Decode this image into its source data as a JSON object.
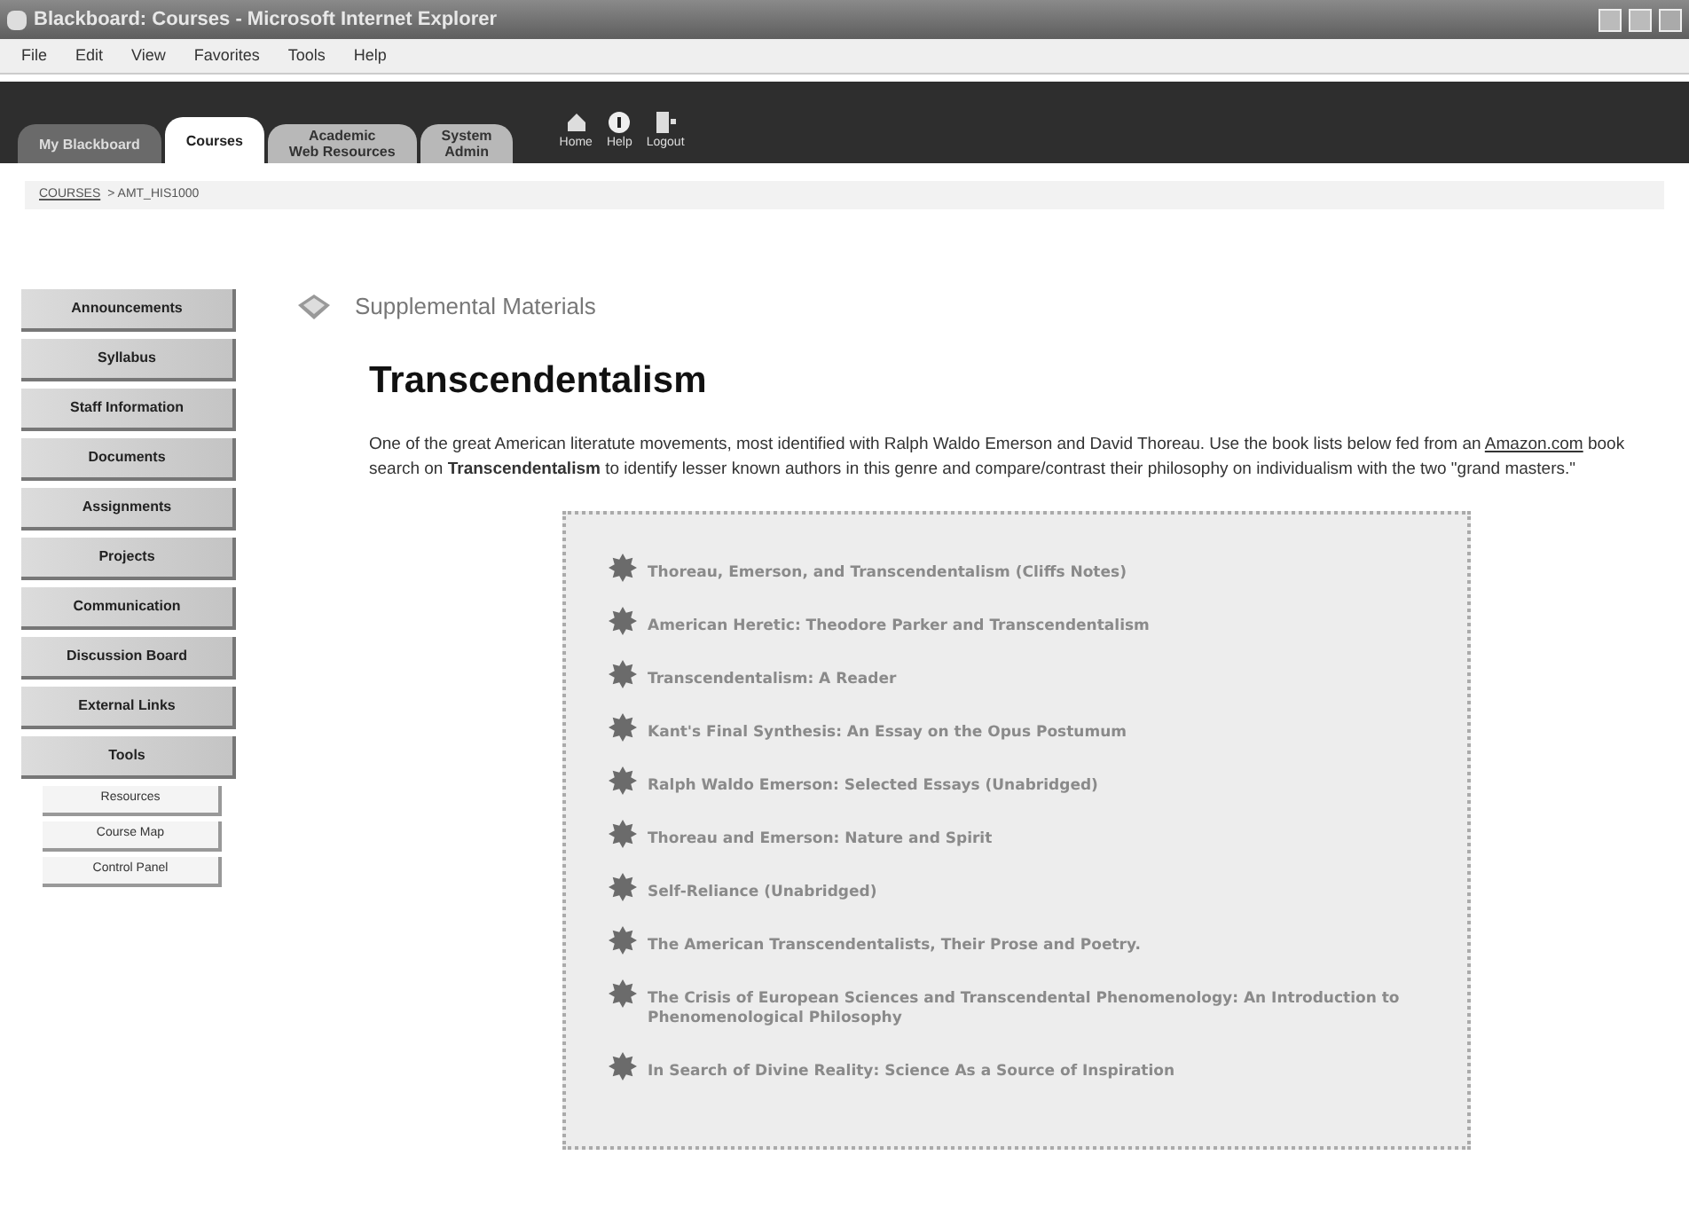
{
  "window": {
    "title": "Blackboard: Courses - Microsoft Internet Explorer"
  },
  "menu": [
    "File",
    "Edit",
    "View",
    "Favorites",
    "Tools",
    "Help"
  ],
  "tabs": [
    {
      "label": "My Blackboard",
      "selected": false
    },
    {
      "label": "Courses",
      "selected": true
    },
    {
      "label": "Academic\nWeb Resources",
      "selected": false
    },
    {
      "label": "System\nAdmin",
      "selected": false
    }
  ],
  "top_links": [
    {
      "kind": "home",
      "label": "Home"
    },
    {
      "kind": "help",
      "label": "Help"
    },
    {
      "kind": "logout",
      "label": "Logout"
    }
  ],
  "breadcrumb": {
    "link": "COURSES",
    "current": "> AMT_HIS1000"
  },
  "nav": [
    "Announcements",
    "Syllabus",
    "Staff Information",
    "Documents",
    "Assignments",
    "Projects",
    "Communication",
    "Discussion Board",
    "External Links",
    "Tools"
  ],
  "subnav": [
    "Resources",
    "Course Map",
    "Control Panel"
  ],
  "section": "Supplemental Materials",
  "heading": "Transcendentalism",
  "intro": {
    "before": "One of the great American literatute movements, most identified with Ralph Waldo Emerson and David Thoreau. Use the book lists below fed from an ",
    "link": "Amazon.com",
    "after": " book search on **Transcendentalism** to identify lesser known authors in this genre and compare/contrast their philosophy on individualism with the two \"grand masters.\""
  },
  "books": [
    "Thoreau, Emerson, and Transcendentalism (Cliffs Notes)",
    "American Heretic: Theodore Parker and Transcendentalism",
    "Transcendentalism: A Reader",
    "Kant's Final Synthesis: An Essay on the Opus Postumum",
    "Ralph Waldo Emerson: Selected Essays (Unabridged)",
    "Thoreau and Emerson: Nature and Spirit",
    "Self-Reliance (Unabridged)",
    "The American Transcendentalists, Their Prose and Poetry.",
    "The Crisis of European Sciences and Transcendental Phenomenology: An Introduction to Phenomenological Philosophy",
    "In Search of Divine Reality: Science As a Source of Inspiration"
  ]
}
